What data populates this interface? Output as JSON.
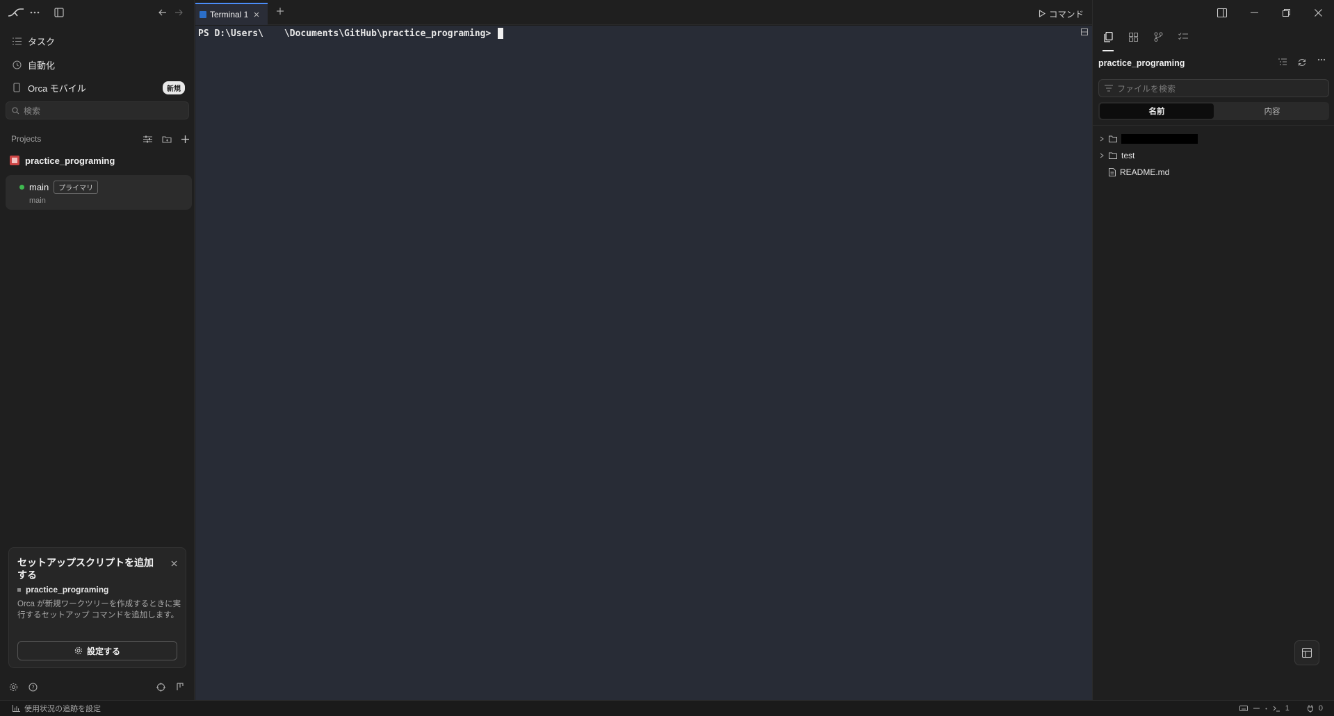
{
  "sidebar": {
    "nav": [
      {
        "label": "タスク",
        "icon": "list-icon"
      },
      {
        "label": "自動化",
        "icon": "clock-icon"
      },
      {
        "label": "Orca モバイル",
        "icon": "mobile-icon",
        "badge": "新規"
      }
    ],
    "search_placeholder": "検索",
    "projects_label": "Projects",
    "project": {
      "name": "practice_programing"
    },
    "worktree": {
      "name": "main",
      "tag": "プライマリ",
      "branch": "main"
    },
    "setup_card": {
      "title": "セットアップスクリプトを追加する",
      "project": "practice_programing",
      "description": "Orca が新規ワークツリーを作成するときに実行するセットアップ コマンドを追加します。",
      "button": "設定する"
    }
  },
  "tabbar": {
    "tabs": [
      {
        "label": "Terminal 1",
        "active": true
      }
    ],
    "command_label": "コマンド"
  },
  "terminal": {
    "prompt_prefix": "PS D:\\Users\\",
    "prompt_suffix": "\\Documents\\GitHub\\practice_programing> "
  },
  "right_panel": {
    "title": "practice_programing",
    "search_placeholder": "ファイルを検索",
    "segments": [
      "名前",
      "内容"
    ],
    "tree": [
      {
        "type": "folder",
        "name": ""
      },
      {
        "type": "folder",
        "name": "test"
      },
      {
        "type": "file",
        "name": "README.md"
      }
    ]
  },
  "statusbar": {
    "tracking_label": "使用状況の追跡を設定",
    "terminal_count": "1",
    "port_count": "0"
  },
  "colors": {
    "terminal_bg": "#282c36",
    "accent": "#4b8df8",
    "status_green": "#3fb950"
  }
}
